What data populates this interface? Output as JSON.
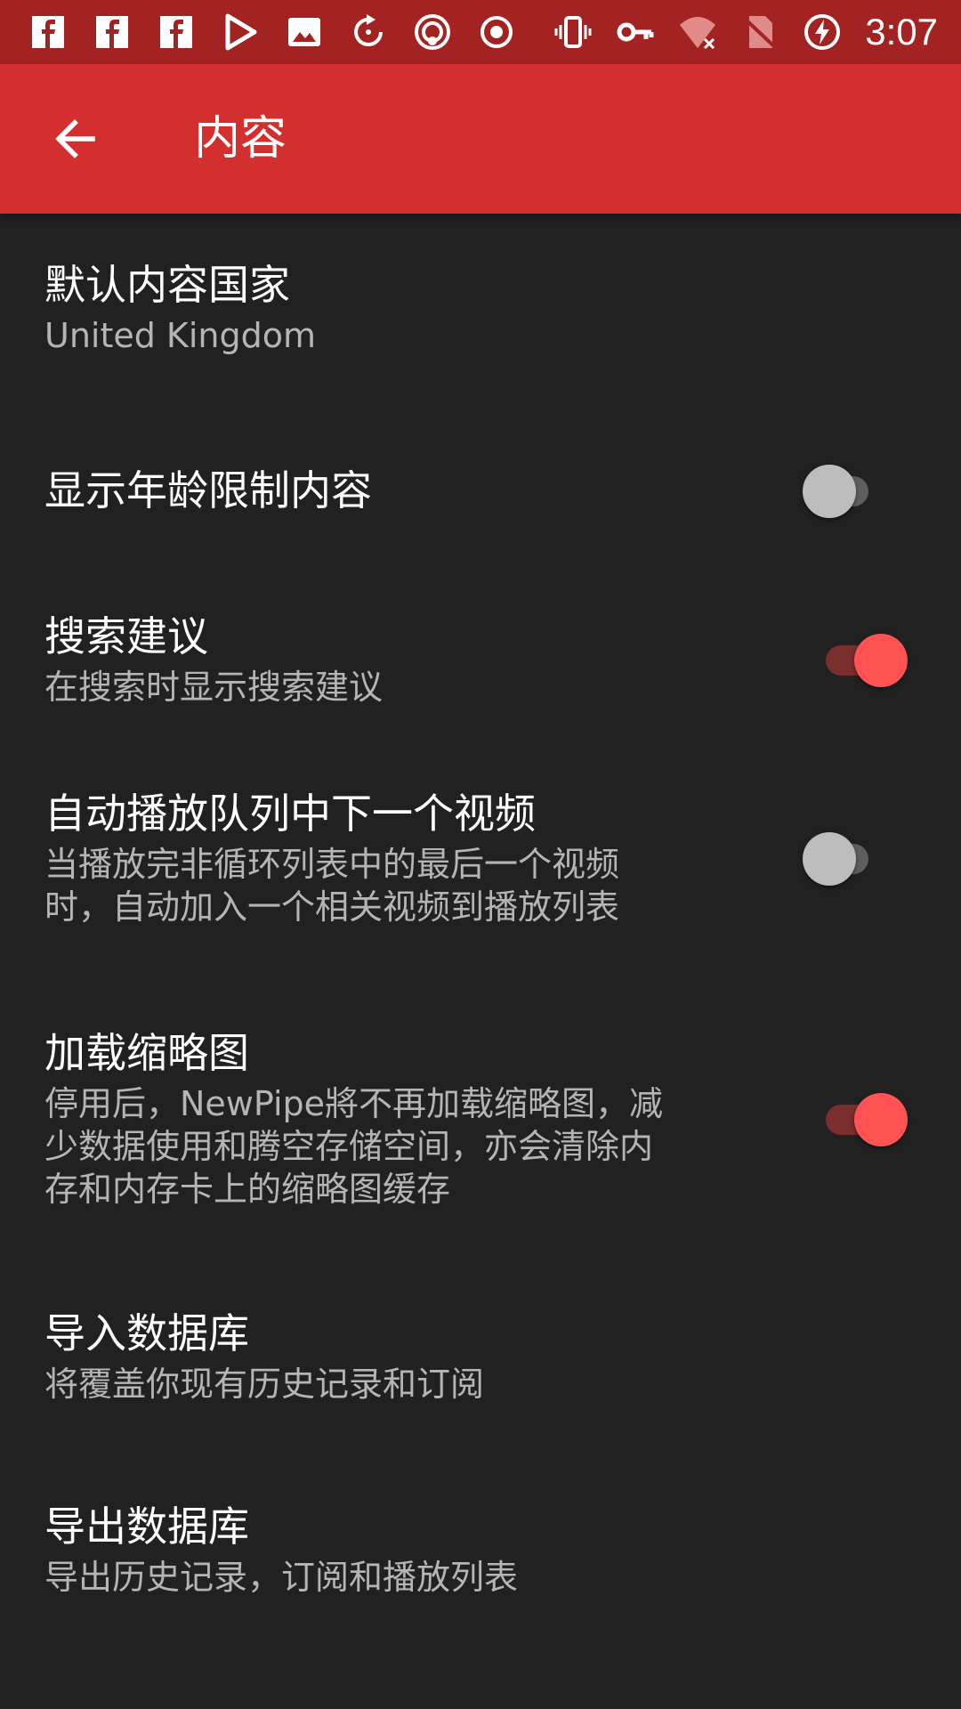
{
  "status_bar": {
    "time": "3:07",
    "left_icons": [
      "facebook-icon",
      "facebook-icon",
      "facebook-icon",
      "play-store-icon",
      "image-icon",
      "sync-icon",
      "podcast-icon",
      "record-icon"
    ],
    "right_icons": [
      "vibrate-icon",
      "vpn-key-icon",
      "wifi-off-icon",
      "no-sim-icon",
      "battery-charging-icon"
    ]
  },
  "app_bar": {
    "title": "内容",
    "back_icon": "arrow-back-icon",
    "color": "#d32f2f"
  },
  "preferences": [
    {
      "title": "默认内容国家",
      "summary": "United Kingdom"
    },
    {
      "title": "显示年龄限制内容",
      "switch": false
    },
    {
      "title": "搜索建议",
      "summary": "在搜索时显示搜索建议",
      "switch": true
    },
    {
      "title": "自动播放队列中下一个视频",
      "summary_lines": [
        "当播放完非循环列表中的最后一个视频",
        "时，自动加入一个相关视频到播放列表"
      ],
      "switch": false
    },
    {
      "title": "加载缩略图",
      "summary_lines": [
        "停用后，NewPipe將不再加载缩略图，减",
        "少数据使用和腾空存储空间，亦会清除内",
        "存和内存卡上的缩略图缓存"
      ],
      "switch": true
    },
    {
      "title": "导入数据库",
      "summary": "将覆盖你现有历史记录和订阅"
    },
    {
      "title": "导出数据库",
      "summary": "导出历史记录，订阅和播放列表"
    }
  ],
  "colors": {
    "background": "#212121",
    "status_bar": "#a32222",
    "accent": "#ff5252"
  }
}
